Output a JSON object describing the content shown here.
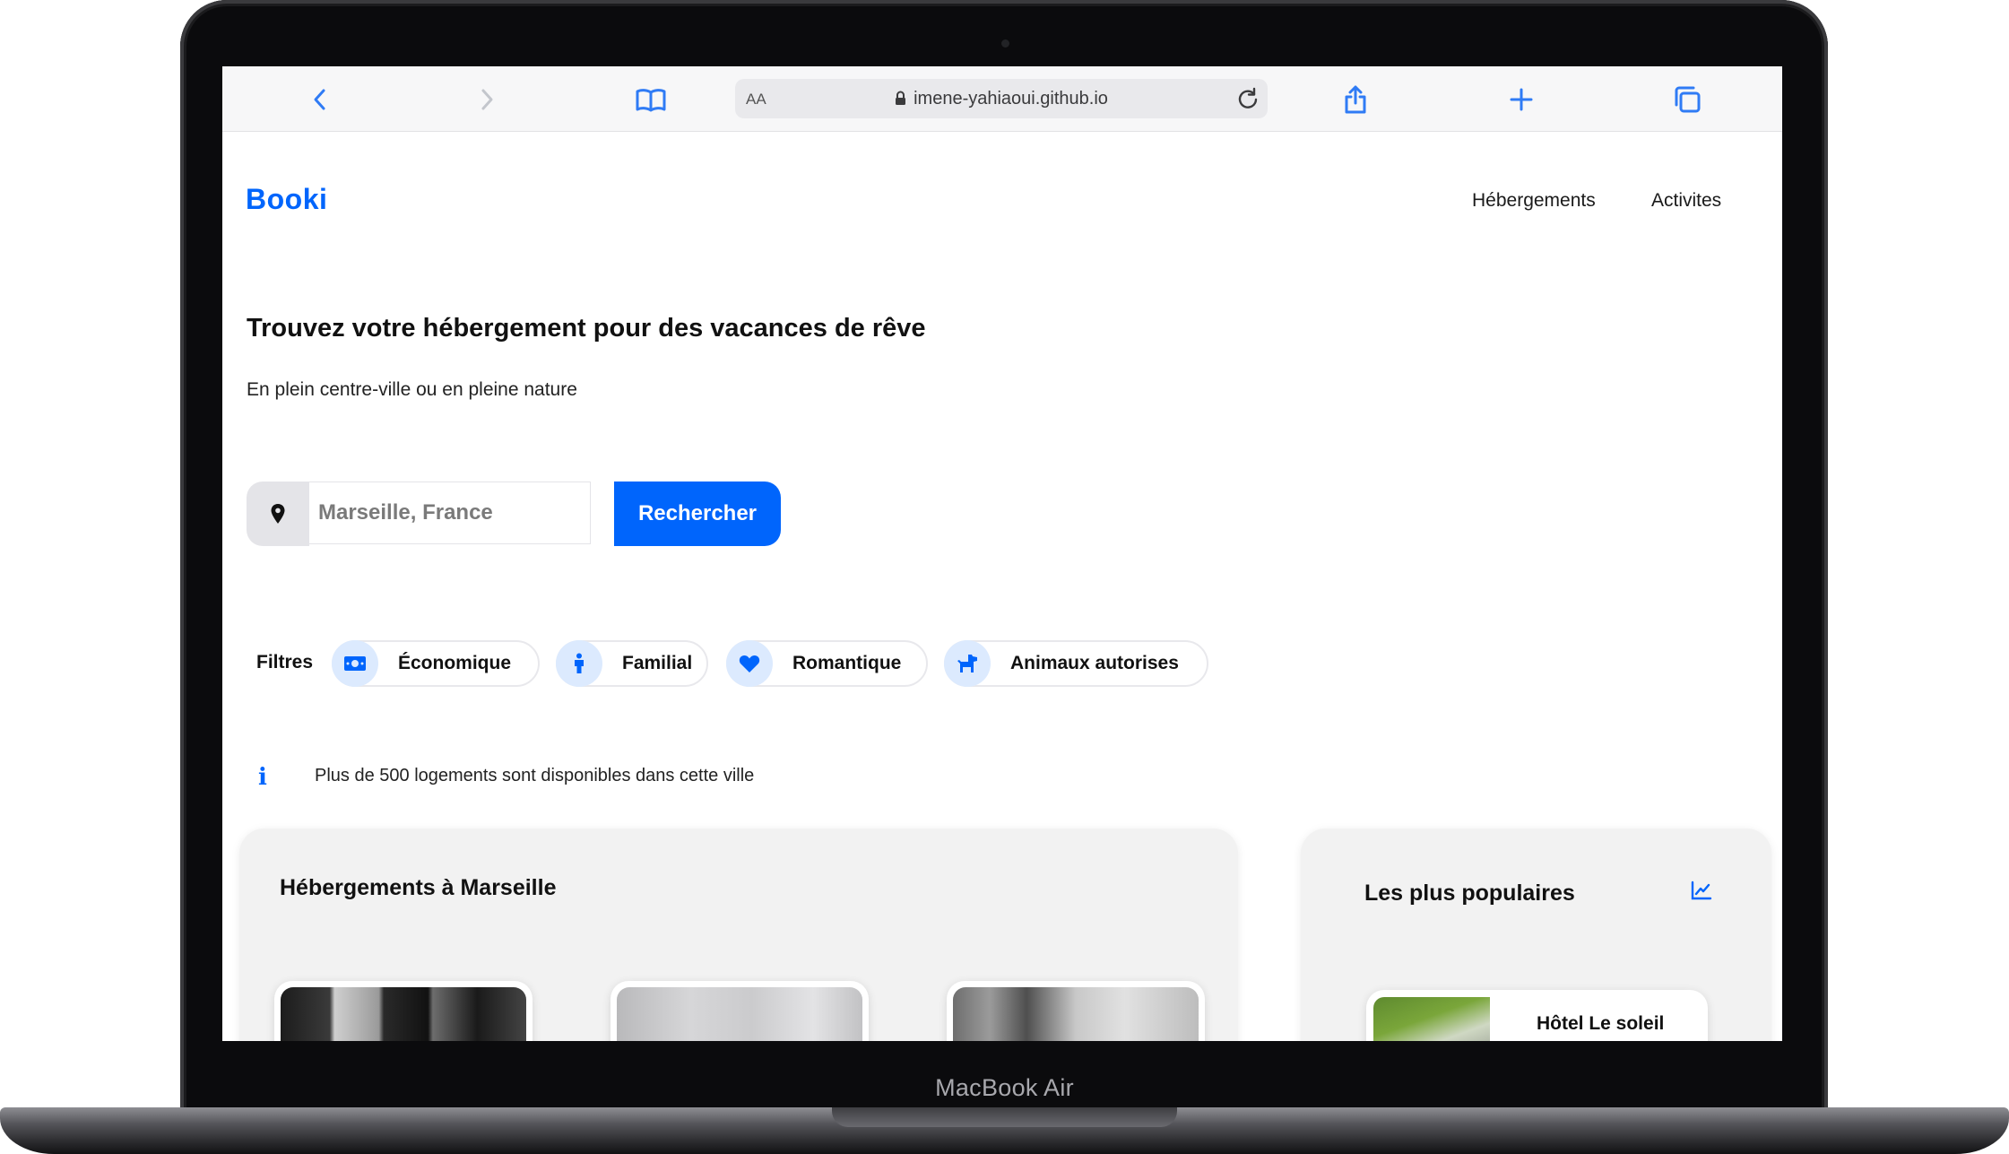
{
  "device": {
    "label": "MacBook Air"
  },
  "browser": {
    "text_size_label": "AA",
    "url": "imene-yahiaoui.github.io",
    "icons": [
      "back-icon",
      "forward-icon",
      "bookmarks-icon",
      "lock-icon",
      "reload-icon",
      "share-icon",
      "new-tab-icon",
      "tabs-icon"
    ]
  },
  "site": {
    "logo": "Booki",
    "nav": [
      "Hébergements",
      "Activites"
    ],
    "hero": {
      "title": "Trouvez votre hébergement pour des vacances de rêve",
      "subtitle": "En plein centre-ville ou en pleine nature"
    },
    "search": {
      "value": "Marseille, France",
      "button_label": "Rechercher",
      "icon": "map-pin-icon"
    },
    "filters": {
      "label": "Filtres",
      "items": [
        {
          "label": "Économique",
          "icon": "money-icon"
        },
        {
          "label": "Familial",
          "icon": "person-icon"
        },
        {
          "label": "Romantique",
          "icon": "heart-icon"
        },
        {
          "label": "Animaux autorises",
          "icon": "dog-icon"
        }
      ]
    },
    "info": {
      "text": "Plus de 500 logements sont disponibles dans cette ville",
      "icon": "info-icon"
    },
    "accommodations": {
      "title": "Hébergements à Marseille"
    },
    "popular": {
      "title": "Les plus populaires",
      "icon": "trend-chart-icon",
      "items": [
        {
          "name": "Hôtel Le soleil"
        }
      ]
    }
  },
  "colors": {
    "brand": "#0065fc",
    "chip_icon_bg": "#dceafe",
    "panel_bg": "#f2f2f2"
  }
}
